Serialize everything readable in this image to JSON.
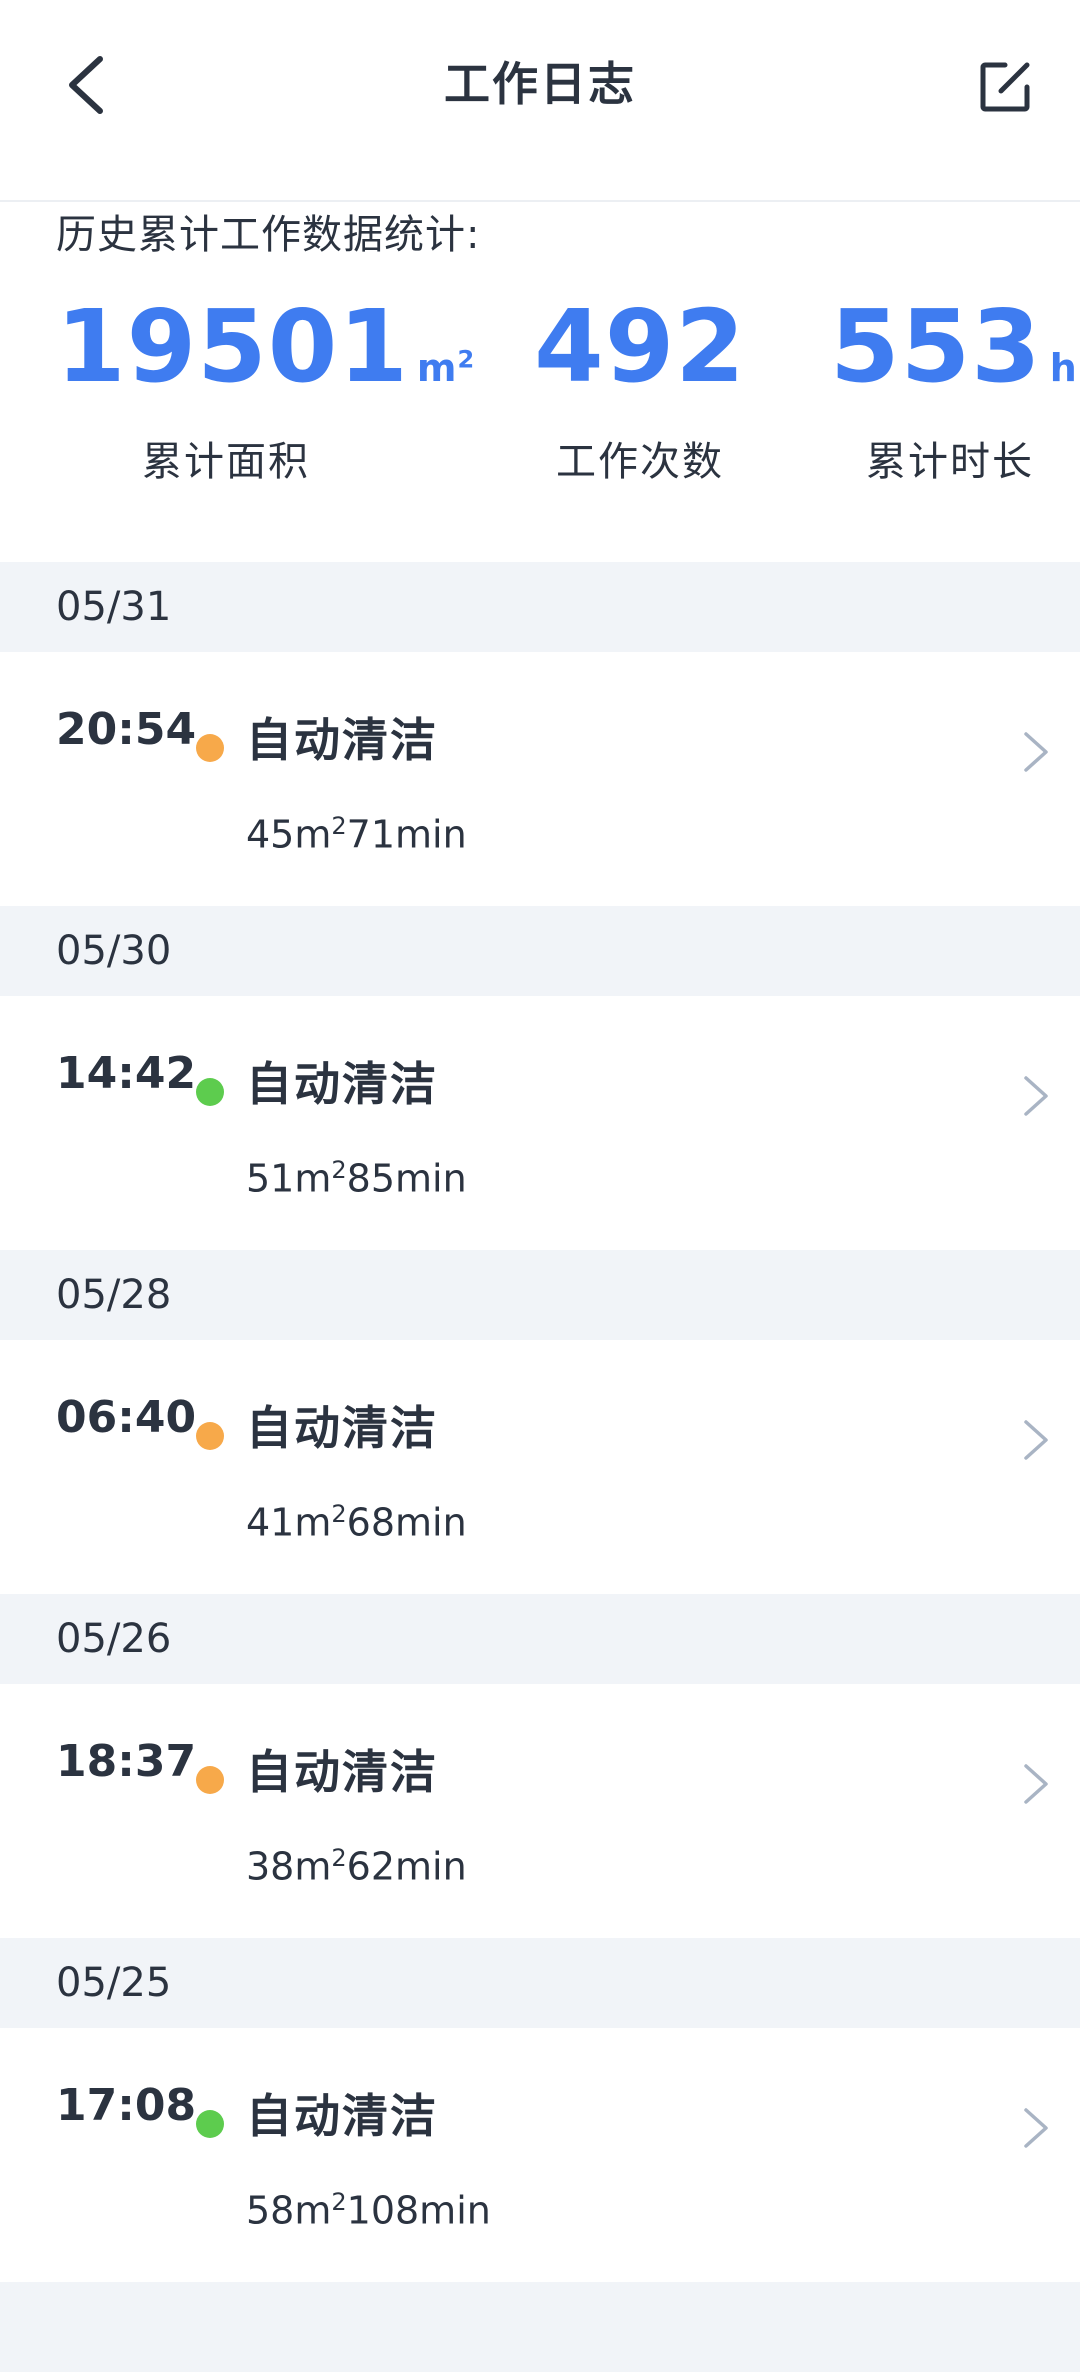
{
  "header": {
    "title": "工作日志",
    "back_icon": "back-arrow-icon",
    "edit_icon": "edit-icon"
  },
  "stats": {
    "label": "历史累计工作数据统计:",
    "area": {
      "value": "19501",
      "unit": "m",
      "unit_sup": "2",
      "caption": "累计面积"
    },
    "count": {
      "value": "492",
      "caption": "工作次数"
    },
    "duration": {
      "value": "553",
      "unit": "h",
      "caption": "累计时长"
    }
  },
  "colors": {
    "accent": "#3f7cf0",
    "status_orange": "#f7a94a",
    "status_green": "#5dcc4e",
    "section_bg": "#f1f4f8"
  },
  "logs": [
    {
      "date": "05/31",
      "time": "20:54",
      "status_color": "#f7a94a",
      "type": "自动清洁",
      "area": "45m",
      "sup": "2",
      "duration": "71min"
    },
    {
      "date": "05/30",
      "time": "14:42",
      "status_color": "#5dcc4e",
      "type": "自动清洁",
      "area": "51m",
      "sup": "2",
      "duration": "85min"
    },
    {
      "date": "05/28",
      "time": "06:40",
      "status_color": "#f7a94a",
      "type": "自动清洁",
      "area": "41m",
      "sup": "2",
      "duration": "68min"
    },
    {
      "date": "05/26",
      "time": "18:37",
      "status_color": "#f7a94a",
      "type": "自动清洁",
      "area": "38m",
      "sup": "2",
      "duration": "62min"
    },
    {
      "date": "05/25",
      "time": "17:08",
      "status_color": "#5dcc4e",
      "type": "自动清洁",
      "area": "58m",
      "sup": "2",
      "duration": "108min"
    }
  ]
}
